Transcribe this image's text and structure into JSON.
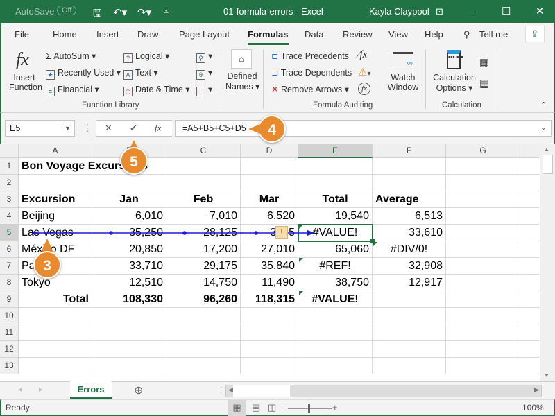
{
  "titlebar": {
    "autosave": "AutoSave",
    "autosave_state": "Off",
    "title": "01-formula-errors  -  Excel",
    "user": "Kayla Claypool"
  },
  "tabs": [
    "File",
    "Home",
    "Insert",
    "Draw",
    "Page Layout",
    "Formulas",
    "Data",
    "Review",
    "View",
    "Help",
    "Tell me"
  ],
  "active_tab": "Formulas",
  "ribbon": {
    "insert_function": [
      "Insert",
      "Function"
    ],
    "autosum": "AutoSum",
    "recently_used": "Recently Used",
    "financial": "Financial",
    "logical": "Logical",
    "text": "Text",
    "date_time": "Date & Time",
    "defined_names": [
      "Defined",
      "Names"
    ],
    "function_library": "Function Library",
    "trace_precedents": "Trace Precedents",
    "trace_dependents": "Trace Dependents",
    "remove_arrows": "Remove Arrows",
    "watch_window": [
      "Watch",
      "Window"
    ],
    "formula_auditing": "Formula Auditing",
    "calc_options": [
      "Calculation",
      "Options"
    ],
    "calculation": "Calculation"
  },
  "formula_bar": {
    "name_box": "E5",
    "formula": "=A5+B5+C5+D5"
  },
  "columns": [
    "A",
    "B",
    "C",
    "D",
    "E",
    "F",
    "G"
  ],
  "selected_cell": "E5",
  "rows": [
    [
      {
        "v": "Bon Voyage Excursions",
        "s": "l b"
      }
    ],
    [],
    [
      {
        "v": "Excursion",
        "s": "l b"
      },
      {
        "v": "Jan",
        "s": "c b"
      },
      {
        "v": "Feb",
        "s": "c b"
      },
      {
        "v": "Mar",
        "s": "c b"
      },
      {
        "v": "Total",
        "s": "c b"
      },
      {
        "v": "Average",
        "s": "l b"
      }
    ],
    [
      {
        "v": "Beijing",
        "s": "l"
      },
      {
        "v": "6,010",
        "s": "r"
      },
      {
        "v": "7,010",
        "s": "r"
      },
      {
        "v": "6,520",
        "s": "r"
      },
      {
        "v": "19,540",
        "s": "r"
      },
      {
        "v": "6,513",
        "s": "r"
      }
    ],
    [
      {
        "v": "Las Vegas",
        "s": "l"
      },
      {
        "v": "35,250",
        "s": "r"
      },
      {
        "v": "28,125",
        "s": "r"
      },
      {
        "v": "37,   5",
        "s": "r"
      },
      {
        "v": "#VALUE!",
        "s": "c"
      },
      {
        "v": "33,610",
        "s": "r"
      }
    ],
    [
      {
        "v": "México DF",
        "s": "l"
      },
      {
        "v": "20,850",
        "s": "r"
      },
      {
        "v": "17,200",
        "s": "r"
      },
      {
        "v": "27,010",
        "s": "r"
      },
      {
        "v": "65,060",
        "s": "r"
      },
      {
        "v": "#DIV/0!",
        "s": "c"
      }
    ],
    [
      {
        "v": "Paris",
        "s": "l"
      },
      {
        "v": "33,710",
        "s": "r"
      },
      {
        "v": "29,175",
        "s": "r"
      },
      {
        "v": "35,840",
        "s": "r"
      },
      {
        "v": "#REF!",
        "s": "c"
      },
      {
        "v": "32,908",
        "s": "r"
      }
    ],
    [
      {
        "v": "Tokyo",
        "s": "l"
      },
      {
        "v": "12,510",
        "s": "r"
      },
      {
        "v": "14,750",
        "s": "r"
      },
      {
        "v": "11,490",
        "s": "r"
      },
      {
        "v": "38,750",
        "s": "r"
      },
      {
        "v": "12,917",
        "s": "r"
      }
    ],
    [
      {
        "v": "Total",
        "s": "r b"
      },
      {
        "v": "108,330",
        "s": "r b"
      },
      {
        "v": "96,260",
        "s": "r b"
      },
      {
        "v": "118,315",
        "s": "r b"
      },
      {
        "v": "#VALUE!",
        "s": "c b"
      },
      {
        "v": "",
        "s": "r"
      }
    ],
    [],
    [],
    [],
    []
  ],
  "callouts": {
    "c3": "3",
    "c4": "4",
    "c5": "5"
  },
  "trace_arrow_color": "#1a1adb",
  "sheet_tab": "Errors",
  "status": {
    "ready": "Ready",
    "zoom": "100%"
  }
}
